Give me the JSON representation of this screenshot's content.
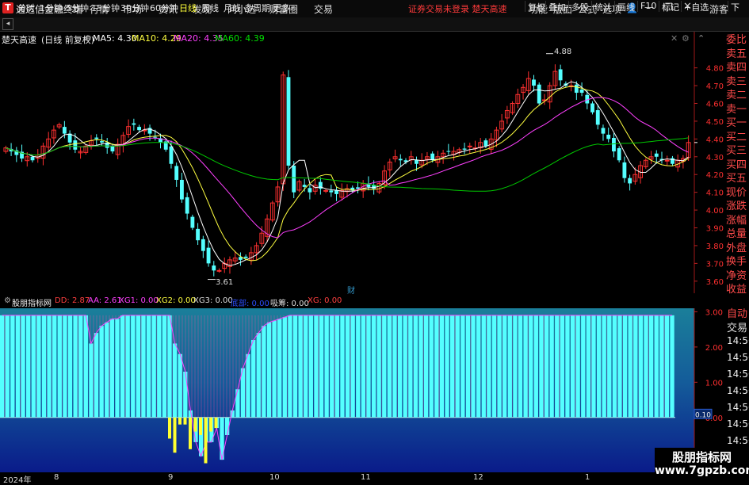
{
  "app": {
    "title": "通达信金融终端",
    "logo": "T"
  },
  "menu": [
    "行情",
    "市场",
    "资讯",
    "发现",
    "问小达",
    "财富圈",
    "交易"
  ],
  "top_status": "证券交易未登录  楚天高速",
  "right_menu": [
    "功能",
    "版面",
    "公式",
    "选项"
  ],
  "window_user": "游客",
  "toolbar": {
    "periods": [
      "分时",
      "1分钟",
      "5分钟",
      "15分钟",
      "30分钟",
      "60分钟",
      "日线",
      "周线",
      "月线",
      "多周期",
      "更多"
    ],
    "active_period": "日线",
    "right_buttons": [
      "复权",
      "叠加",
      "多股",
      "统计",
      "画线",
      "F10",
      "标记",
      "+自选"
    ],
    "next_label": "下"
  },
  "chart_header": {
    "stock": "楚天高速",
    "period_note": "(日线 前复权)",
    "ma5": "MA5: 4.30",
    "ma10": "MA10: 4.29",
    "ma20": "MA20: 4.35",
    "ma60": "MA60: 4.39"
  },
  "main_annotations": {
    "high": "4.88",
    "low": "3.61",
    "cai_marker": "财"
  },
  "indicator_header": {
    "name": "股朋指标网",
    "dd": "DD: 2.87",
    "aa": "AA: 2.61",
    "xg1": "XG1: 0.00",
    "xg2": "XG2: 0.00",
    "xg3": "XG3: 0.00",
    "xg_blue": "底部: 0.00",
    "xichou": "吸筹: 0.00",
    "xg": "XG: 0.00"
  },
  "indicator_axis": [
    "3.00",
    "2.00",
    "1.00",
    "0.00",
    "-1.00"
  ],
  "indicator_marker": "0.10",
  "right_panel": {
    "red": [
      "委比",
      "卖五",
      "卖四",
      "卖三",
      "卖二",
      "卖一",
      "买一",
      "买二",
      "买三",
      "买四",
      "买五",
      "现价",
      "涨跌",
      "涨幅",
      "总量",
      "外盘",
      "换手",
      "净资",
      "收益"
    ],
    "lower_first": "自动",
    "lower_second": "交易",
    "times": [
      "14:56",
      "14:56",
      "14:56",
      "14:56",
      "14:56",
      "14:56",
      "14:56",
      "14:56"
    ]
  },
  "x_axis": [
    "2024年",
    "8",
    "9",
    "10",
    "11",
    "12",
    "1"
  ],
  "watermark": {
    "title": "股朋指标网",
    "url": "www.7gpzb.com"
  },
  "colors": {
    "up": "#ff3030",
    "down": "#54ffff",
    "ma5": "#ffffff",
    "ma10": "#ffff40",
    "ma20": "#ff40ff",
    "ma60": "#00c800",
    "axis_red": "#ff3030"
  },
  "chart_data": {
    "type": "candlestick",
    "price_axis": {
      "ylim": [
        3.55,
        4.95
      ],
      "ticks": [
        4.8,
        4.7,
        4.6,
        4.5,
        4.4,
        4.3,
        4.2,
        4.1,
        4.0,
        3.9,
        3.8,
        3.7,
        3.6
      ]
    },
    "closes": [
      4.35,
      4.33,
      4.31,
      4.29,
      4.3,
      4.28,
      4.31,
      4.36,
      4.4,
      4.45,
      4.48,
      4.43,
      4.38,
      4.34,
      4.33,
      4.36,
      4.39,
      4.4,
      4.38,
      4.35,
      4.33,
      4.37,
      4.42,
      4.47,
      4.48,
      4.45,
      4.45,
      4.43,
      4.41,
      4.38,
      4.34,
      4.26,
      4.17,
      4.06,
      3.98,
      3.9,
      3.83,
      3.77,
      3.7,
      3.66,
      3.66,
      3.7,
      3.72,
      3.73,
      3.72,
      3.73,
      3.76,
      3.8,
      3.87,
      3.95,
      4.04,
      4.13,
      4.76,
      4.25,
      4.1,
      4.16,
      4.13,
      4.1,
      4.14,
      4.12,
      4.11,
      4.1,
      4.09,
      4.11,
      4.12,
      4.11,
      4.12,
      4.15,
      4.13,
      4.12,
      4.15,
      4.22,
      4.27,
      4.3,
      4.28,
      4.27,
      4.3,
      4.26,
      4.28,
      4.3,
      4.28,
      4.3,
      4.32,
      4.33,
      4.33,
      4.34,
      4.34,
      4.36,
      4.35,
      4.38,
      4.36,
      4.4,
      4.45,
      4.5,
      4.56,
      4.6,
      4.65,
      4.69,
      4.74,
      4.7,
      4.6,
      4.62,
      4.7,
      4.78,
      4.73,
      4.7,
      4.7,
      4.66,
      4.66,
      4.6,
      4.55,
      4.48,
      4.43,
      4.4,
      4.33,
      4.28,
      4.18,
      4.15,
      4.2,
      4.25,
      4.28,
      4.3,
      4.3,
      4.28,
      4.28,
      4.26,
      4.28,
      4.29,
      4.38
    ]
  },
  "indicator_data": {
    "type": "bar",
    "ylim": [
      -1.4,
      3.1
    ],
    "dd": [
      2.9,
      2.9,
      2.9,
      2.9,
      2.9,
      2.9,
      2.9,
      2.9,
      2.9,
      2.9,
      2.9,
      2.9,
      2.9,
      2.9,
      2.9,
      2.9,
      2.9,
      2.1,
      2.4,
      2.6,
      2.7,
      2.8,
      2.8,
      2.9,
      2.9,
      2.9,
      2.9,
      2.9,
      2.9,
      2.9,
      2.9,
      2.9,
      2.9,
      2.1,
      1.8,
      1.3,
      0.2,
      -0.7,
      -1.1,
      -0.7,
      -0.7,
      -0.3,
      -1.2,
      -0.5,
      0.2,
      0.8,
      1.4,
      1.8,
      2.2,
      2.4,
      2.6,
      2.7,
      2.75,
      2.8,
      2.85,
      2.9,
      2.9,
      2.9,
      2.9,
      2.9,
      2.9,
      2.9,
      2.9,
      2.9,
      2.9,
      2.9,
      2.9,
      2.9,
      2.9,
      2.9,
      2.9,
      2.9,
      2.9,
      2.9,
      2.9,
      2.9,
      2.9,
      2.9,
      2.9,
      2.9,
      2.9,
      2.9,
      2.9,
      2.9,
      2.9,
      2.9,
      2.9,
      2.9,
      2.9,
      2.9,
      2.9,
      2.9,
      2.9,
      2.9,
      2.9,
      2.9,
      2.9,
      2.9,
      2.9,
      2.9,
      2.9,
      2.9,
      2.9,
      2.9,
      2.9,
      2.9,
      2.9,
      2.9,
      2.9,
      2.9,
      2.9,
      2.9,
      2.9,
      2.9,
      2.9,
      2.9,
      2.9,
      2.9,
      2.9,
      2.9,
      2.9,
      2.9,
      2.9,
      2.9,
      2.9,
      2.9,
      2.9,
      2.9,
      2.9
    ],
    "yellow_bars": [
      -0.6,
      -1.0,
      -0.2,
      -0.2,
      -0.9,
      -0.4,
      -0.5,
      -1.3,
      -0.4,
      -0.3
    ]
  }
}
